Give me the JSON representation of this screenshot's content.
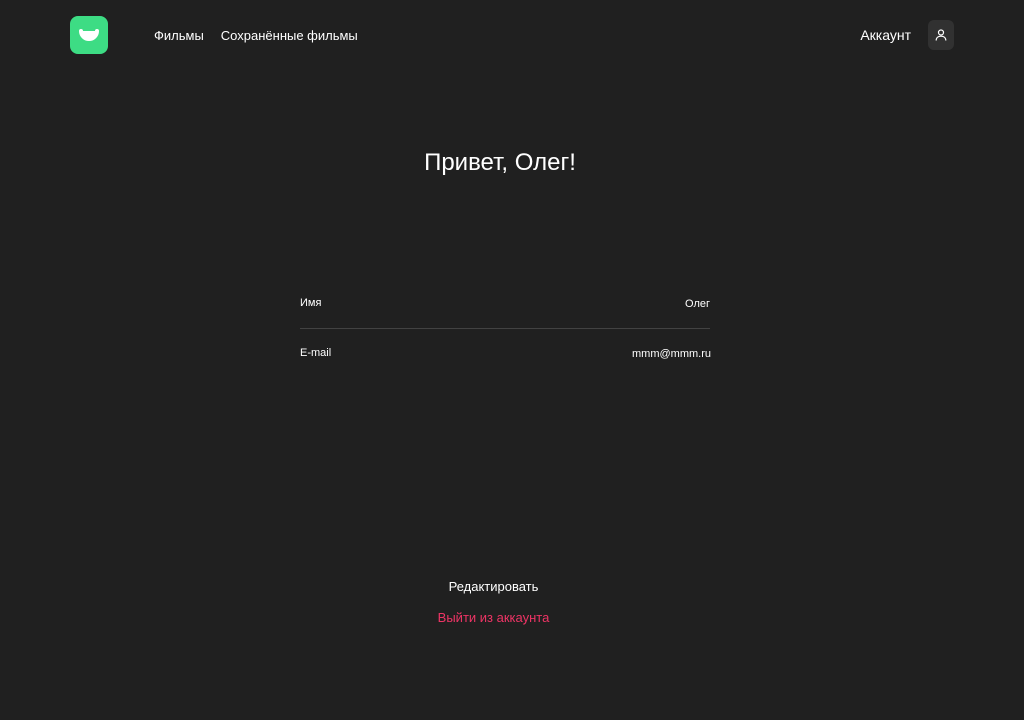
{
  "header": {
    "nav": {
      "movies": "Фильмы",
      "saved_movies": "Сохранённые фильмы"
    },
    "account_label": "Аккаунт"
  },
  "profile": {
    "greeting": "Привет, Олег!",
    "name_label": "Имя",
    "name_value": "Олег",
    "email_label": "E-mail",
    "email_value": "mmm@mmm.ru"
  },
  "actions": {
    "edit": "Редактировать",
    "logout": "Выйти из аккаунта"
  },
  "colors": {
    "background": "#202020",
    "logo": "#3ddc84",
    "logout": "#ee3465",
    "divider": "#424242"
  },
  "icons": {
    "logo": "smile-logo-icon",
    "account": "user-icon"
  }
}
